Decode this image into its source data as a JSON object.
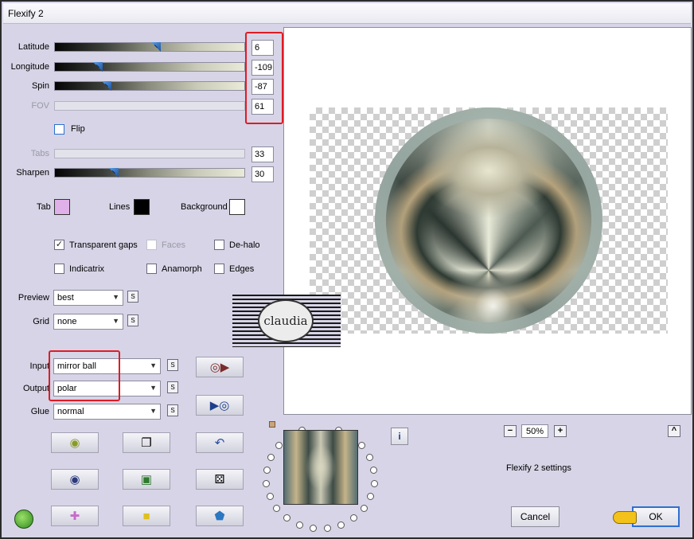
{
  "window": {
    "title": "Flexify 2"
  },
  "sliders": [
    {
      "label": "Latitude",
      "value": "6",
      "position": 0.53,
      "enabled": true
    },
    {
      "label": "Longitude",
      "value": "-109",
      "position": 0.21,
      "enabled": true
    },
    {
      "label": "Spin",
      "value": "-87",
      "position": 0.26,
      "enabled": true
    },
    {
      "label": "FOV",
      "value": "61",
      "position": null,
      "enabled": false
    },
    {
      "label": "Tabs",
      "value": "33",
      "position": null,
      "enabled": false
    },
    {
      "label": "Sharpen",
      "value": "30",
      "position": 0.3,
      "enabled": true
    }
  ],
  "flip": {
    "label": "Flip",
    "checked": false
  },
  "colors": {
    "tab": {
      "label": "Tab",
      "color": "#e0b0e8"
    },
    "lines": {
      "label": "Lines",
      "color": "#000000"
    },
    "background": {
      "label": "Background",
      "color": "#ffffff"
    },
    "highlight": "#e01b24"
  },
  "options": {
    "transparent_gaps": {
      "label": "Transparent gaps",
      "checked": true,
      "enabled": true
    },
    "faces": {
      "label": "Faces",
      "checked": false,
      "enabled": false
    },
    "dehalo": {
      "label": "De-halo",
      "checked": false,
      "enabled": true
    },
    "indicatrix": {
      "label": "Indicatrix",
      "checked": false,
      "enabled": true
    },
    "anamorph": {
      "label": "Anamorph",
      "checked": false,
      "enabled": true
    },
    "edges": {
      "label": "Edges",
      "checked": false,
      "enabled": true
    }
  },
  "selects": {
    "preview": {
      "label": "Preview",
      "value": "best"
    },
    "grid": {
      "label": "Grid",
      "value": "none"
    },
    "input": {
      "label": "Input",
      "value": "mirror ball"
    },
    "output": {
      "label": "Output",
      "value": "polar"
    },
    "glue": {
      "label": "Glue",
      "value": "normal"
    }
  },
  "s_label": "S",
  "watermark": {
    "text": "claudia"
  },
  "zoom": {
    "value": "50%",
    "minus": "−",
    "plus": "+"
  },
  "settings_label": "Flexify 2 settings",
  "buttons": {
    "cancel": "Cancel",
    "ok": "OK",
    "info": "i",
    "collapse": "^"
  }
}
